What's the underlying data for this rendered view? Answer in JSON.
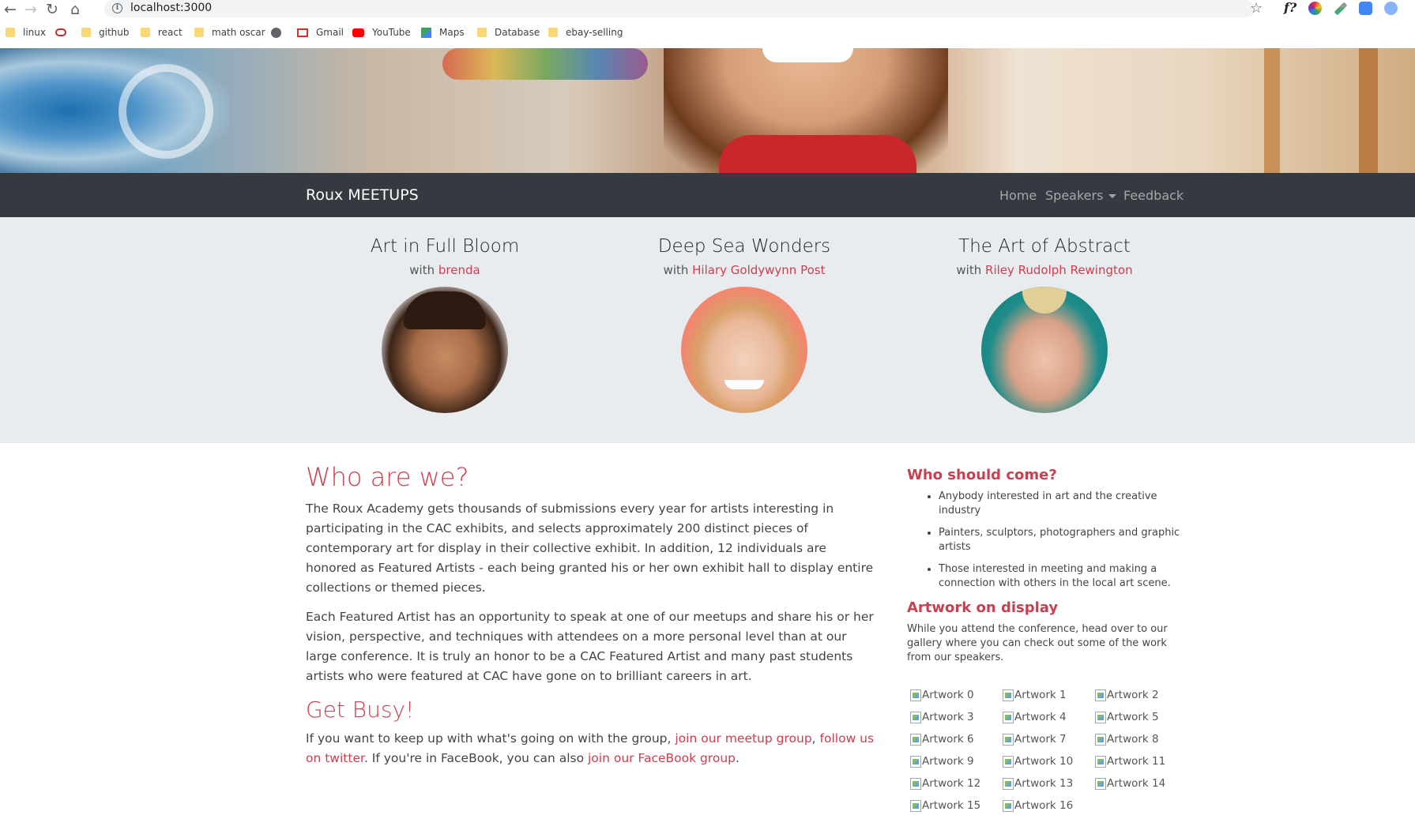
{
  "browser": {
    "url": "localhost:3000",
    "bookmarks": [
      {
        "label": "linux",
        "icon": "folder-icon"
      },
      {
        "label": "",
        "icon": "app-icon"
      },
      {
        "label": "github",
        "icon": "folder-icon"
      },
      {
        "label": "react",
        "icon": "folder-icon"
      },
      {
        "label": "math oscar",
        "icon": "folder-icon"
      },
      {
        "label": "",
        "icon": "globe-icon"
      },
      {
        "label": "Gmail",
        "icon": "gmail-icon"
      },
      {
        "label": "YouTube",
        "icon": "youtube-icon"
      },
      {
        "label": "Maps",
        "icon": "maps-icon"
      },
      {
        "label": "Database",
        "icon": "folder-icon"
      },
      {
        "label": "ebay-selling",
        "icon": "folder-icon"
      }
    ]
  },
  "navbar": {
    "brand": "Roux MEETUPS",
    "links": {
      "home": "Home",
      "speakers": "Speakers",
      "feedback": "Feedback"
    }
  },
  "speakers": [
    {
      "title": "Art in Full Bloom",
      "with": "with",
      "name": "brenda"
    },
    {
      "title": "Deep Sea Wonders",
      "with": "with",
      "name": "Hilary Goldywynn Post"
    },
    {
      "title": "The Art of Abstract",
      "with": "with",
      "name": "Riley Rudolph Rewington"
    }
  ],
  "main": {
    "who_heading": "Who are we?",
    "who_p1": "The Roux Academy gets thousands of submissions every year for artists interesting in participating in the CAC exhibits, and selects approximately 200 distinct pieces of contemporary art for display in their collective exhibit. In addition, 12 individuals are honored as Featured Artists - each being granted his or her own exhibit hall to display entire collections or themed pieces.",
    "who_p2": "Each Featured Artist has an opportunity to speak at one of our meetups and share his or her vision, perspective, and techniques with attendees on a more personal level than at our large conference. It is truly an honor to be a CAC Featured Artist and many past students artists who were featured at CAC have gone on to brilliant careers in art.",
    "busy_heading": "Get Busy!",
    "busy_text_1": "If you want to keep up with what's going on with the group, ",
    "busy_link_1": "join our meetup group",
    "busy_text_2": ", ",
    "busy_link_2": "follow us on twitter",
    "busy_text_3": ". If you're in FaceBook, you can also ",
    "busy_link_3": "join our FaceBook group",
    "busy_text_4": "."
  },
  "sidebar": {
    "who_heading": "Who should come?",
    "who_items": [
      "Anybody interested in art and the creative industry",
      "Painters, sculptors, photographers and graphic artists",
      "Those interested in meeting and making a connection with others in the local art scene."
    ],
    "artwork_heading": "Artwork on display",
    "artwork_text": "While you attend the conference, head over to our gallery where you can check out some of the work from our speakers.",
    "artworks": [
      "Artwork 0",
      "Artwork 1",
      "Artwork 2",
      "Artwork 3",
      "Artwork 4",
      "Artwork 5",
      "Artwork 6",
      "Artwork 7",
      "Artwork 8",
      "Artwork 9",
      "Artwork 10",
      "Artwork 11",
      "Artwork 12",
      "Artwork 13",
      "Artwork 14",
      "Artwork 15",
      "Artwork 16"
    ]
  },
  "colors": {
    "accent": "#c94050",
    "navbar": "#343a40",
    "jumbotron": "#e9ecef"
  }
}
